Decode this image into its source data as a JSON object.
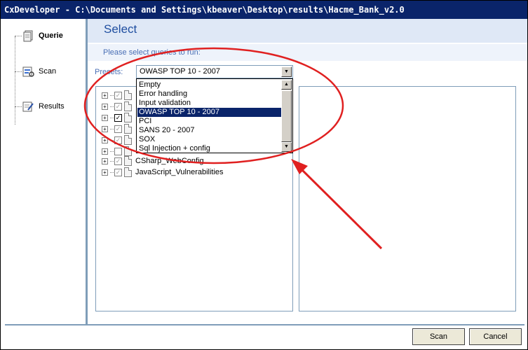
{
  "window": {
    "title": "CxDeveloper - C:\\Documents and Settings\\kbeaver\\Desktop\\results\\Hacme_Bank_v2.0"
  },
  "nav": {
    "items": [
      {
        "label": "Querie",
        "icon": "queries-icon",
        "active": true
      },
      {
        "label": "Scan",
        "icon": "scan-icon",
        "active": false
      },
      {
        "label": "Results",
        "icon": "results-icon",
        "active": false
      }
    ]
  },
  "page": {
    "title": "Select",
    "instructions": "Please select queries to run:"
  },
  "presets": {
    "label": "Presets:",
    "selected": "OWASP TOP 10 - 2007",
    "options": [
      "Empty",
      "Error handling",
      "Input validation",
      "OWASP TOP 10 - 2007",
      "PCI",
      "SANS 20 - 2007",
      "SOX",
      "Sql Injection + config"
    ]
  },
  "query_tree": {
    "visible_items": [
      {
        "label": "CSharp_WebConfig",
        "checked": "grey"
      },
      {
        "label": "JavaScript_Vulnerabilities",
        "checked": "grey"
      }
    ]
  },
  "buttons": {
    "scan": "Scan",
    "cancel": "Cancel"
  },
  "colors": {
    "title_bar": "#0a246a",
    "accent_text": "#1f4ea0",
    "annotation_red": "#e02020"
  }
}
